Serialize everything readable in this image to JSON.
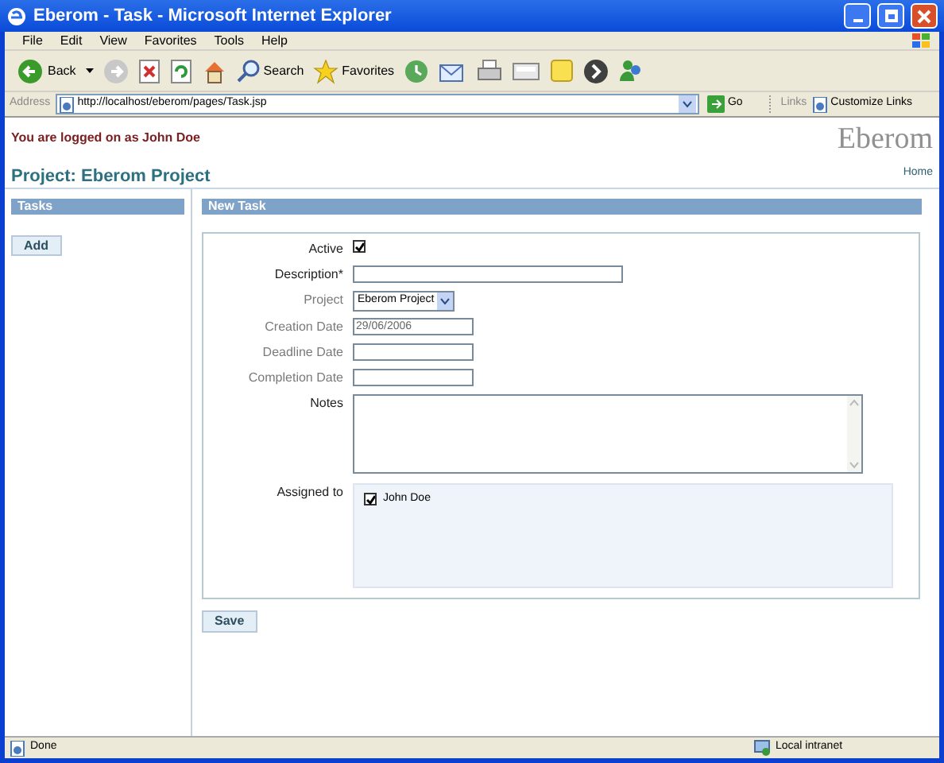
{
  "window": {
    "title": "Eberom - Task - Microsoft Internet Explorer"
  },
  "menu": [
    "File",
    "Edit",
    "View",
    "Favorites",
    "Tools",
    "Help"
  ],
  "toolbar": {
    "back": "Back",
    "search": "Search",
    "favorites": "Favorites"
  },
  "address_bar": {
    "label": "Address",
    "url": "http://localhost/eberom/pages/Task.jsp",
    "go": "Go",
    "links": "Links",
    "customize": "Customize Links"
  },
  "page": {
    "login_notice": "You are logged on as John Doe",
    "logo": "Eberom",
    "project_title": "Project: Eberom Project",
    "home_link": "Home",
    "sidebar": {
      "header": "Tasks",
      "add_button": "Add"
    },
    "form": {
      "header": "New Task",
      "fields": [
        {
          "kind": "checkbox",
          "label": "Active",
          "dimmed": false,
          "checked": true
        },
        {
          "kind": "text",
          "label": "Description*",
          "dimmed": false
        },
        {
          "kind": "select",
          "label": "Project",
          "dimmed": true,
          "value": "Eberom Project"
        },
        {
          "kind": "date",
          "label": "Creation Date",
          "dimmed": true,
          "value": "29/06/2006"
        },
        {
          "kind": "date",
          "label": "Deadline Date",
          "dimmed": true
        },
        {
          "kind": "date",
          "label": "Completion Date",
          "dimmed": true
        },
        {
          "kind": "textarea",
          "label": "Notes",
          "dimmed": false
        },
        {
          "kind": "assignees",
          "label": "Assigned to",
          "dimmed": false,
          "people": [
            {
              "name": "John Doe",
              "checked": true
            }
          ]
        }
      ]
    },
    "save_button": "Save"
  },
  "status_bar": {
    "status": "Done",
    "zone": "Local intranet"
  }
}
